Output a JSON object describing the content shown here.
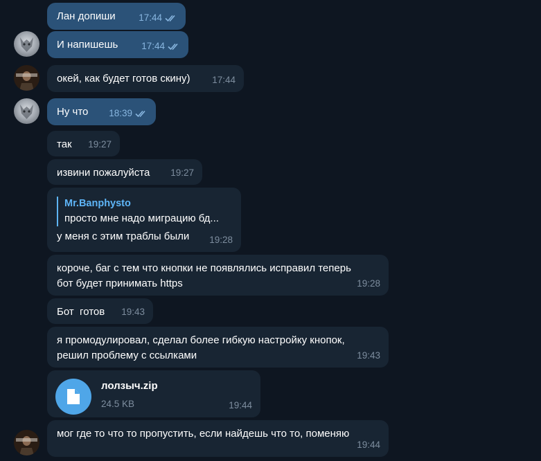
{
  "messages": [
    {
      "text": "Лан допиши",
      "time": "17:44"
    },
    {
      "text": "И напишешь",
      "time": "17:44"
    },
    {
      "text": "окей, как будет готов скину)",
      "time": "17:44"
    },
    {
      "text": "Ну что",
      "time": "18:39"
    },
    {
      "text": "так",
      "time": "19:27"
    },
    {
      "text": "извини пожалуйста",
      "time": "19:27"
    },
    {
      "reply_name": "Mr.Banphysto",
      "reply_text": "просто мне надо миграцию бд...",
      "text": "у меня с этим траблы были",
      "time": "19:28"
    },
    {
      "text_line1": "короче, баг с тем что кнопки не появлялись исправил теперь",
      "text_line2": "бот будет принимать https",
      "time": "19:28"
    },
    {
      "text": "Бот  готов",
      "time": "19:43"
    },
    {
      "text_line1": "я промодулировал, сделал более гибкую настройку кнопок,",
      "text_line2": "решил проблему с ссылками",
      "time": "19:43"
    },
    {
      "file_name": "лолзыч.zip",
      "file_size": "24.5 KB",
      "time": "19:44"
    },
    {
      "text": "мог где то что то пропустить, если найдешь что то, поменяю",
      "time": "19:44"
    }
  ],
  "icons": {
    "read_receipt": "double-check-icon",
    "file": "document-icon",
    "avatar_self": "wolf-avatar",
    "avatar_peer": "banphysto-avatar"
  },
  "colors": {
    "background": "#0e1621",
    "incoming_bubble": "#182533",
    "outgoing_bubble": "#2b5278",
    "accent": "#5eb5f7"
  }
}
